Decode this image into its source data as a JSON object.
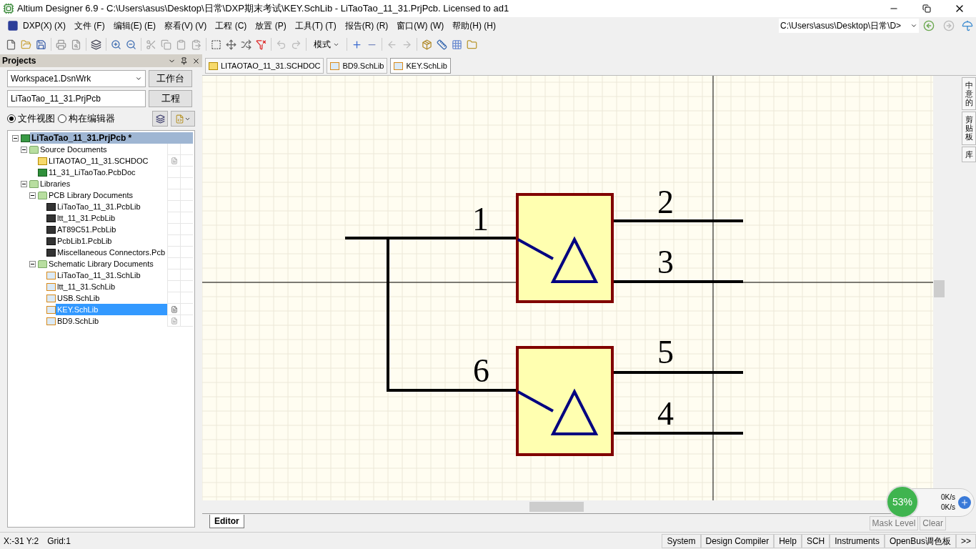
{
  "window": {
    "title": "Altium Designer 6.9 - C:\\Users\\asus\\Desktop\\日常\\DXP期末考试\\KEY.SchLib - LiTaoTao_11_31.PrjPcb. Licensed to ad1"
  },
  "menu": [
    "DXP(X) (X)",
    "文件 (F)",
    "编辑(E) (E)",
    "察看(V) (V)",
    "工程 (C)",
    "放置 (P)",
    "工具(T) (T)",
    "报告(R) (R)",
    "窗口(W) (W)",
    "帮助(H) (H)"
  ],
  "path_field": {
    "value": "C:\\Users\\asus\\Desktop\\日常\\D>"
  },
  "toolbar": {
    "mode_button": "模式"
  },
  "projects_panel": {
    "title": "Projects",
    "workspace": {
      "value": "Workspace1.DsnWrk",
      "button": "工作台"
    },
    "project": {
      "value": "LiTaoTao_11_31.PrjPcb",
      "button": "工程"
    },
    "views": [
      {
        "label": "文件视图",
        "selected": true
      },
      {
        "label": "构在编辑器",
        "selected": false
      }
    ],
    "tree": {
      "label": "LiTaoTao_11_31.PrjPcb *",
      "kind": "project",
      "children": [
        {
          "label": "Source Documents",
          "kind": "folder",
          "children": [
            {
              "label": "LITAOTAO_11_31.SCHDOC",
              "kind": "schdoc",
              "selected": false,
              "open": true
            },
            {
              "label": "11_31_LiTaoTao.PcbDoc",
              "kind": "pcbdoc",
              "selected": false,
              "open": false
            }
          ]
        },
        {
          "label": "Libraries",
          "kind": "folder",
          "children": [
            {
              "label": "PCB Library Documents",
              "kind": "folder",
              "children": [
                {
                  "label": "LiTaoTao_11_31.PcbLib",
                  "kind": "pcblib",
                  "selected": false,
                  "open": false
                },
                {
                  "label": "ltt_11_31.PcbLib",
                  "kind": "pcblib",
                  "selected": false,
                  "open": false
                },
                {
                  "label": "AT89C51.PcbLib",
                  "kind": "pcblib",
                  "selected": false,
                  "open": false
                },
                {
                  "label": "PcbLib1.PcbLib",
                  "kind": "pcblib",
                  "selected": false,
                  "open": false
                },
                {
                  "label": "Miscellaneous Connectors.Pcb",
                  "kind": "pcblib",
                  "selected": false,
                  "open": false
                }
              ]
            },
            {
              "label": "Schematic Library Documents",
              "kind": "folder",
              "children": [
                {
                  "label": "LiTaoTao_11_31.SchLib",
                  "kind": "schlib",
                  "selected": false,
                  "open": false
                },
                {
                  "label": "ltt_11_31.SchLib",
                  "kind": "schlib",
                  "selected": false,
                  "open": false
                },
                {
                  "label": "USB.SchLib",
                  "kind": "schlib",
                  "selected": false,
                  "open": false
                },
                {
                  "label": "KEY.SchLib",
                  "kind": "schlib",
                  "selected": true,
                  "open": true
                },
                {
                  "label": "BD9.SchLib",
                  "kind": "schlib",
                  "selected": false,
                  "open": true
                }
              ]
            }
          ]
        }
      ]
    }
  },
  "doc_tabs": [
    {
      "label": "LITAOTAO_11_31.SCHDOC",
      "kind": "schdoc",
      "selected": false
    },
    {
      "label": "BD9.SchLib",
      "kind": "schlib",
      "selected": false
    },
    {
      "label": "KEY.SchLib",
      "kind": "schlib",
      "selected": true
    }
  ],
  "schematic": {
    "pins": [
      "1",
      "2",
      "3",
      "6",
      "5",
      "4"
    ]
  },
  "right_tabs": [
    "中意的",
    "剪贴板",
    "库"
  ],
  "editor_tab": "Editor",
  "mask_buttons": [
    "Mask Level",
    "Clear"
  ],
  "net_widget": {
    "percent": "53%",
    "up": "0K/s",
    "down": "0K/s"
  },
  "status_bar": {
    "coords": "X:-31 Y:2",
    "grid": "Grid:1",
    "panels": [
      "System",
      "Design Compiler",
      "Help",
      "SCH",
      "Instruments",
      "OpenBus调色板",
      ">>"
    ]
  }
}
